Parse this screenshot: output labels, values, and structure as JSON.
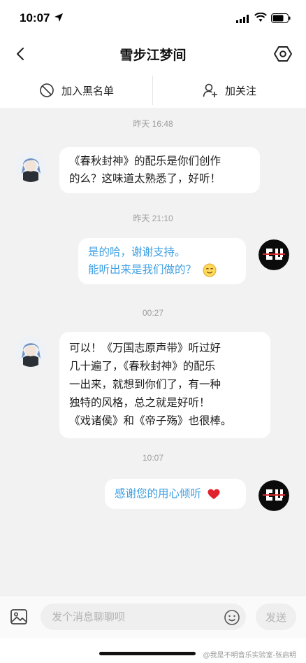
{
  "status_bar": {
    "time": "10:07"
  },
  "header": {
    "title": "雪步江梦间"
  },
  "actions": {
    "block_label": "加入黑名单",
    "follow_label": "加关注"
  },
  "messages": [
    {
      "timestamp": "昨天 16:48",
      "side": "in",
      "lines": [
        "《春秋封神》的配乐是你们创作",
        "的么？这味道太熟悉了，好听！"
      ]
    },
    {
      "timestamp": "昨天 21:10",
      "side": "out",
      "lines": [
        "是的哈，谢谢支持。",
        "能听出来是我们做的？"
      ],
      "emoji": "smile-emoji"
    },
    {
      "timestamp": "00:27",
      "side": "in",
      "lines": [
        "可以！《万国志原声带》听过好",
        "几十遍了，《春秋封神》的配乐",
        "一出来，就想到你们了，有一种",
        "独特的风格，总之就是好听！",
        "《戏诸侯》和《帝子殇》也很棒。"
      ]
    },
    {
      "timestamp": "10:07",
      "side": "out",
      "lines": [
        "感谢您的用心倾听"
      ],
      "emoji": "red-heart"
    }
  ],
  "input": {
    "placeholder": "发个消息聊聊呗",
    "send_label": "发送"
  },
  "watermark": "@我是不明音乐实验室-张启明",
  "colors": {
    "outgoing_text": "#3fa0e4",
    "chat_background": "#f2f2f2",
    "heart": "#e0242e"
  }
}
